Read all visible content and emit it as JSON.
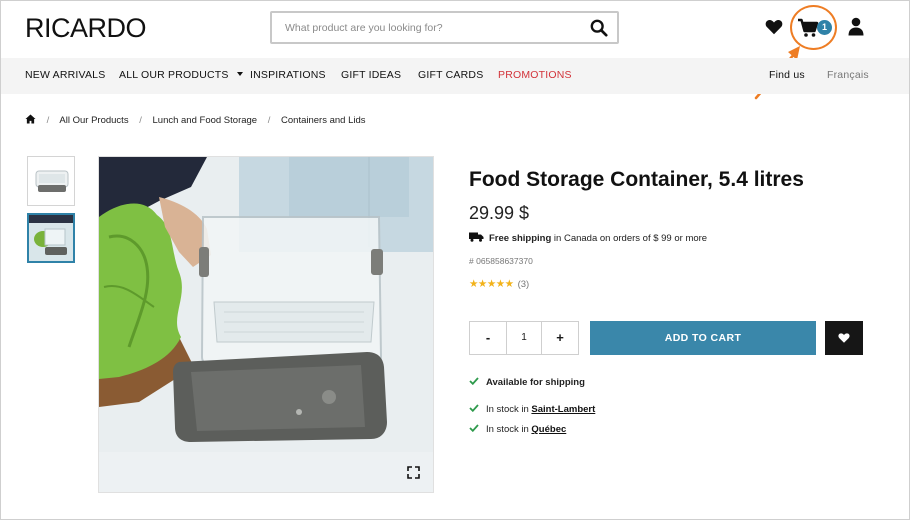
{
  "header": {
    "logo": "RICARDO",
    "search_placeholder": "What product are you looking for?",
    "cart_count": "1"
  },
  "nav": {
    "items": [
      {
        "label": "NEW ARRIVALS"
      },
      {
        "label": "ALL OUR PRODUCTS"
      },
      {
        "label": "INSPIRATIONS"
      },
      {
        "label": "GIFT IDEAS"
      },
      {
        "label": "GIFT CARDS"
      },
      {
        "label": "PROMOTIONS"
      }
    ],
    "find_us": "Find us",
    "language": "Français"
  },
  "breadcrumb": {
    "items": [
      "All Our Products",
      "Lunch and Food Storage",
      "Containers and Lids"
    ]
  },
  "product": {
    "title": "Food Storage Container, 5.4 litres",
    "price": "29.99 $",
    "shipping_bold": "Free shipping",
    "shipping_rest": " in Canada on orders of $ 99 or more",
    "sku": "# 065858637370",
    "rating_stars": "★★★★★",
    "rating": 5,
    "review_count": "(3)",
    "qty_minus": "-",
    "qty_value": "1",
    "qty_plus": "+",
    "add_to_cart": "ADD TO CART",
    "available_shipping": "Available for shipping",
    "stock": [
      {
        "prefix": "In stock in ",
        "store": "Saint-Lambert"
      },
      {
        "prefix": "In stock in ",
        "store": "Québec"
      }
    ]
  },
  "colors": {
    "accent": "#3a87aa",
    "promo": "#d2333a",
    "annotation": "#ee7d24",
    "stars": "#f2b21a",
    "check": "#2e9a4c"
  },
  "icons": [
    "search-icon",
    "heart-icon",
    "cart-icon",
    "user-icon",
    "home-icon",
    "truck-icon",
    "check-icon",
    "expand-icon"
  ]
}
